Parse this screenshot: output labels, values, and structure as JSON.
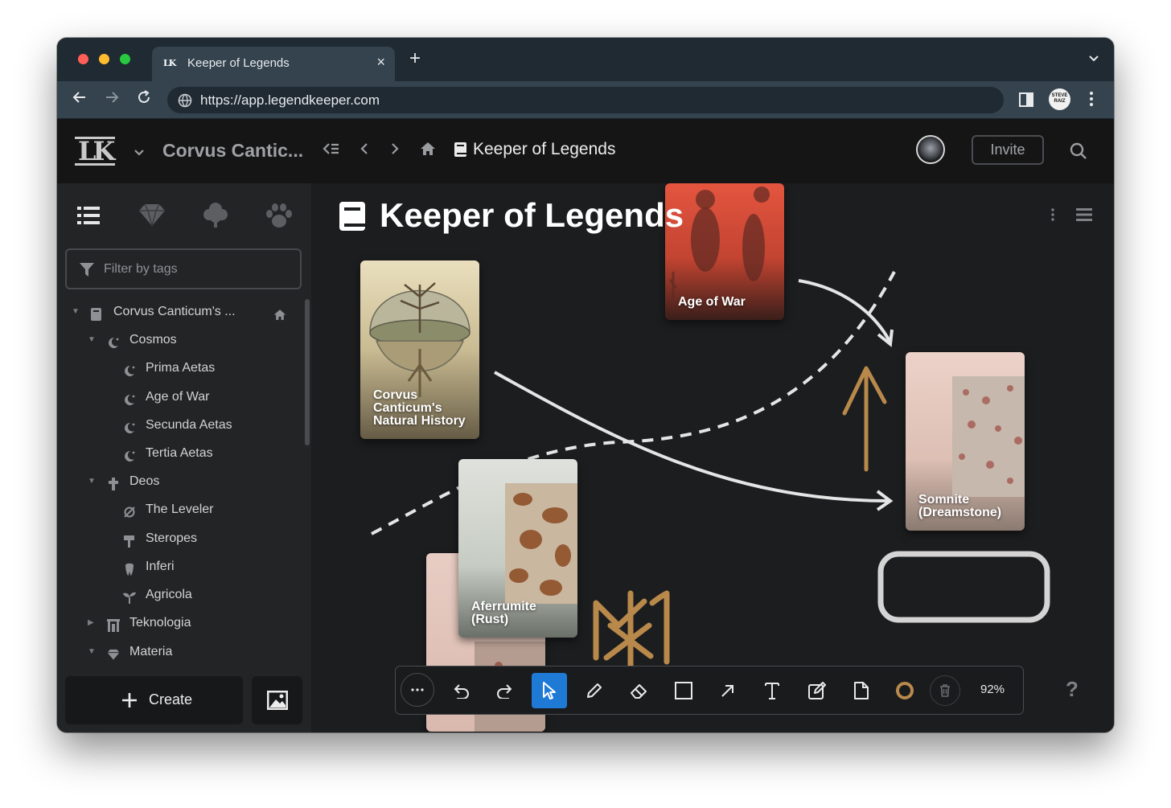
{
  "browser": {
    "tab_favicon": "LK",
    "tab_title": "Keeper of Legends",
    "tab_close": "×",
    "new_tab": "+",
    "url": "https://app.legendkeeper.com",
    "profile_initials": "STEVE RAIZ"
  },
  "header": {
    "logo": "LK",
    "world_name": "Corvus Cantic...",
    "breadcrumb_title": "Keeper of Legends",
    "invite_label": "Invite"
  },
  "sidebar": {
    "filter_placeholder": "Filter by tags",
    "tree": [
      {
        "label": "Corvus Canticum's ...",
        "icon": "book-icon",
        "expanded": true
      },
      {
        "label": "Cosmos",
        "icon": "moon-star-icon",
        "expanded": true
      },
      {
        "label": "Prima Aetas",
        "icon": "moon-star-icon"
      },
      {
        "label": "Age of War",
        "icon": "moon-star-icon"
      },
      {
        "label": "Secunda Aetas",
        "icon": "moon-star-icon"
      },
      {
        "label": "Tertia Aetas",
        "icon": "moon-star-icon"
      },
      {
        "label": "Deos",
        "icon": "cross-icon",
        "expanded": true
      },
      {
        "label": "The Leveler",
        "icon": "empty-set-icon"
      },
      {
        "label": "Steropes",
        "icon": "hammer-icon"
      },
      {
        "label": "Inferi",
        "icon": "tooth-icon"
      },
      {
        "label": "Agricola",
        "icon": "sprout-icon"
      },
      {
        "label": "Teknologia",
        "icon": "building-icon",
        "expanded": false
      },
      {
        "label": "Materia",
        "icon": "gem-icon",
        "expanded": true
      }
    ],
    "create_label": "Create"
  },
  "canvas": {
    "title": "Keeper of Legends",
    "cards": {
      "history": "Corvus Canticum's Natural History",
      "war": "Age of War",
      "somnite": "Somnite (Dreamstone)",
      "aferrumite": "Aferrumite (Rust)"
    },
    "zoom": "92%",
    "help": "?",
    "accent_color": "#b8894a"
  }
}
